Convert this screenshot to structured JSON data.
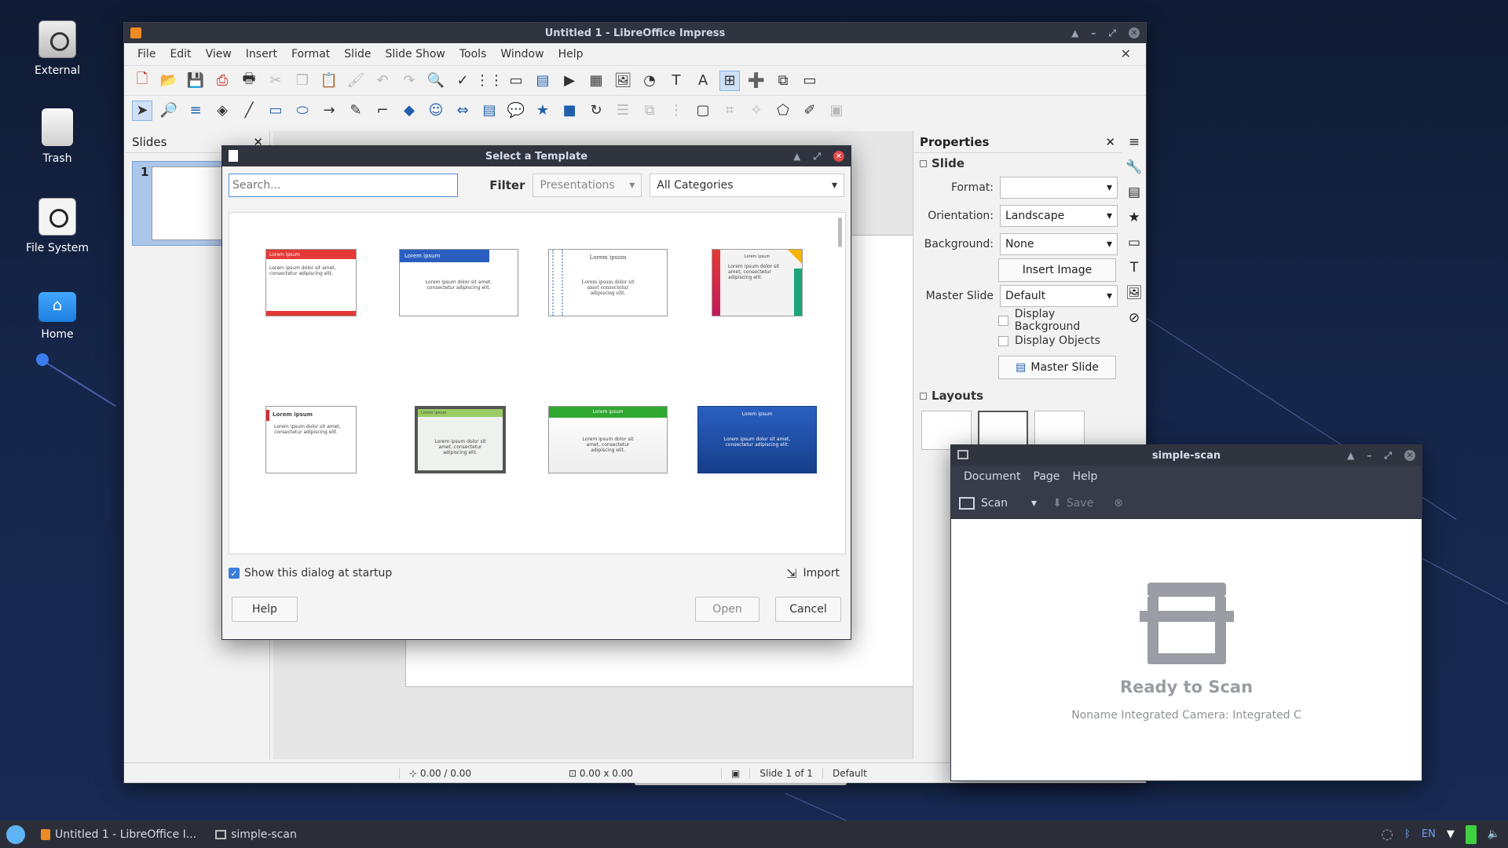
{
  "desktop": {
    "icons": [
      {
        "label": "External"
      },
      {
        "label": "Trash"
      },
      {
        "label": "File System"
      },
      {
        "label": "Home"
      }
    ]
  },
  "impress": {
    "title": "Untitled 1 - LibreOffice Impress",
    "menu": [
      "File",
      "Edit",
      "View",
      "Insert",
      "Format",
      "Slide",
      "Slide Show",
      "Tools",
      "Window",
      "Help"
    ],
    "slides_pane_title": "Slides",
    "slide_number": "1",
    "statusbar": {
      "position": "0.00 / 0.00",
      "size": "0.00 x 0.00",
      "slide": "Slide 1 of 1",
      "master": "Default"
    },
    "properties": {
      "title": "Properties",
      "slide_section": "Slide",
      "format_label": "Format:",
      "format_value": "",
      "orientation_label": "Orientation:",
      "orientation_value": "Landscape",
      "background_label": "Background:",
      "background_value": "None",
      "insert_image": "Insert Image",
      "master_slide_label": "Master Slide",
      "master_slide_value": "Default",
      "display_background": "Display Background",
      "display_objects": "Display Objects",
      "master_slide_button": "Master Slide",
      "layouts_section": "Layouts"
    }
  },
  "template_dialog": {
    "title": "Select a Template",
    "search_placeholder": "Search...",
    "filter_label": "Filter",
    "filter_value": "Presentations",
    "category_value": "All Categories",
    "templates": [
      {
        "heading": "Lorem ipsum",
        "body": "Lorem ipsum dolor sit amet, consectetur adipiscing elit.",
        "accent": "#e53935"
      },
      {
        "heading": "Lorem ipsum",
        "body": "Lorem ipsum dolor sit amet, consectetur adipiscing elit.",
        "accent": "#2a5fc1"
      },
      {
        "heading": "Lorem ipsum",
        "body": "Lorem ipsum dolor sit amet consectetur adipiscing elit.",
        "accent": "#8fb0d8"
      },
      {
        "heading": "Lorem ipsum",
        "body": "Lorem ipsum dolor sit amet, consectetur adipiscing elit.",
        "accent": "#c2185b"
      },
      {
        "heading": "Lorem ipsum",
        "body": "Lorem ipsum dolor sit amet, consectetur adipiscing elit.",
        "accent": "#d32f2f"
      },
      {
        "heading": "Lorem ipsum",
        "body": "Lorem ipsum dolor sit amet, consectetur adipiscing elit.",
        "accent": "#9ccc65"
      },
      {
        "heading": "Lorem ipsum",
        "body": "Lorem ipsum dolor sit amet, consectetur adipiscing elit.",
        "accent": "#2fa82f"
      },
      {
        "heading": "Lorem ipsum",
        "body": "Lorem ipsum dolor sit amet, consectetur adipiscing elit.",
        "accent": "#1e4ea8"
      }
    ],
    "show_at_startup": "Show this dialog at startup",
    "import": "Import",
    "help": "Help",
    "open": "Open",
    "cancel": "Cancel"
  },
  "scan": {
    "title": "simple-scan",
    "menu": [
      "Document",
      "Page",
      "Help"
    ],
    "scan_button": "Scan",
    "save_button": "Save",
    "ready": "Ready to Scan",
    "device": "Noname Integrated Camera: Integrated C"
  },
  "taskbar": {
    "tasks": [
      {
        "label": "Untitled 1 - LibreOffice I..."
      },
      {
        "label": "simple-scan"
      }
    ],
    "keyboard": "EN"
  }
}
